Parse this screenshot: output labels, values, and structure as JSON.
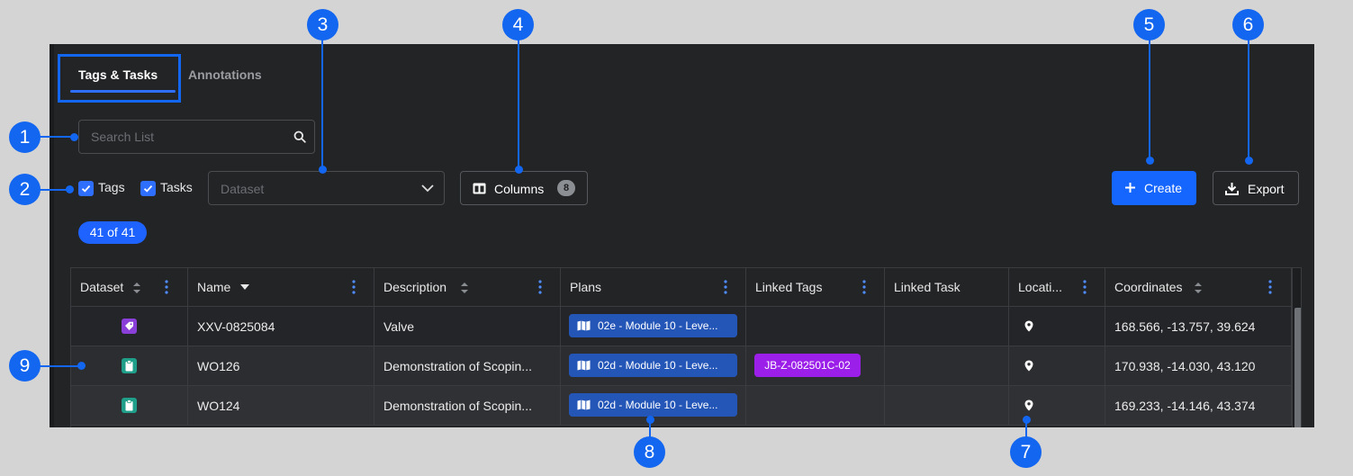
{
  "tabs": [
    {
      "label": "Tags & Tasks",
      "active": true
    },
    {
      "label": "Annotations",
      "active": false
    }
  ],
  "search": {
    "placeholder": "Search List"
  },
  "filters": {
    "tags_label": "Tags",
    "tags_checked": true,
    "tasks_label": "Tasks",
    "tasks_checked": true,
    "dataset_placeholder": "Dataset"
  },
  "toolbar": {
    "columns_label": "Columns",
    "columns_count": "8",
    "create_label": "Create",
    "export_label": "Export"
  },
  "result_count": "41 of 41",
  "table": {
    "columns": [
      "Dataset",
      "Name",
      "Description",
      "Plans",
      "Linked Tags",
      "Linked Task",
      "Locati...",
      "Coordinates"
    ],
    "rows": [
      {
        "type": "tag",
        "name": "XXV-0825084",
        "description": "Valve",
        "plan": "02e - Module 10 - Leve...",
        "linked_tag": "",
        "linked_task": "",
        "coordinates": "168.566, -13.757, 39.624"
      },
      {
        "type": "task",
        "name": "WO126",
        "description": "Demonstration of Scopin...",
        "plan": "02d - Module 10 - Leve...",
        "linked_tag": "JB-Z-082501C-02",
        "linked_task": "",
        "coordinates": "170.938, -14.030, 43.120"
      },
      {
        "type": "task",
        "name": "WO124",
        "description": "Demonstration of Scopin...",
        "plan": "02d - Module 10 - Leve...",
        "linked_tag": "",
        "linked_task": "",
        "coordinates": "169.233, -14.146, 43.374"
      }
    ]
  },
  "callouts": [
    "1",
    "2",
    "3",
    "4",
    "5",
    "6",
    "7",
    "8",
    "9"
  ],
  "colors": {
    "accent": "#1565ff",
    "callout": "#1366f0",
    "tag_icon": "#8b3fd9",
    "task_icon": "#1f9e8a",
    "linked_tag_chip": "#9b1fe8",
    "plan_chip": "#2456b8",
    "panel_bg": "#232426"
  },
  "icons": {
    "search": "search-icon",
    "chevron": "chevron-down-icon",
    "columns": "columns-icon",
    "create": "plus-icon",
    "export": "download-icon",
    "plan": "map-icon",
    "location": "map-pin-icon",
    "tag_type": "tag-icon",
    "task_type": "clipboard-icon"
  }
}
